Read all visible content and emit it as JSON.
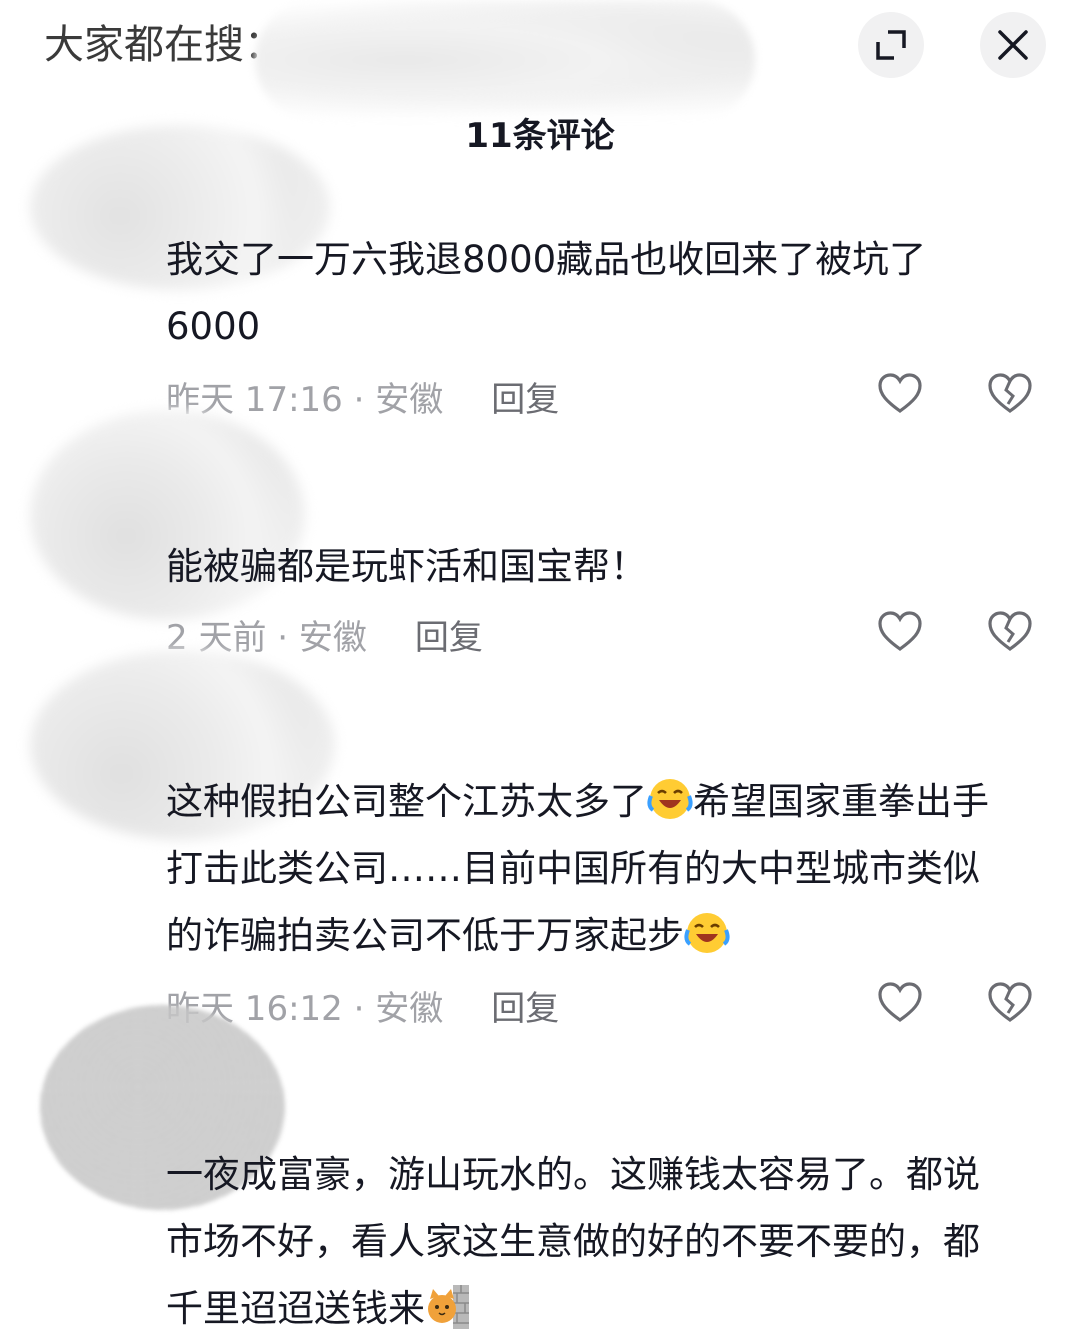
{
  "header": {
    "search_prefix": "大家都在搜：",
    "expand_label": "expand-icon",
    "close_label": "close-icon"
  },
  "comments_count": "11条评论",
  "comments": [
    {
      "text": "我交了一万六我退8000藏品也收回来了被坑了6000",
      "meta": "昨天 17:16 · 安徽",
      "reply": "回复"
    },
    {
      "text": "能被骗都是玩虾活和国宝帮！",
      "meta": "2 天前 · 安徽",
      "reply": "回复"
    },
    {
      "text_a": "这种假拍公司整个江苏太多了",
      "text_b": "希望国家重拳出手打击此类公司……目前中国所有的大中型城市类似的诈骗拍卖公司不低于万家起步",
      "meta": "昨天 16:12 · 安徽",
      "reply": "回复"
    },
    {
      "text": "一夜成富豪，游山玩水的。这赚钱太容易了。都说市场不好，看人家这生意做的好的不要不要的，都千里迢迢送钱来"
    }
  ],
  "colors": {
    "meta_gray": "#a1a2a7",
    "reply_gray": "#6b6c72",
    "text_dark": "#161823",
    "button_bg": "#f1f1f2"
  }
}
